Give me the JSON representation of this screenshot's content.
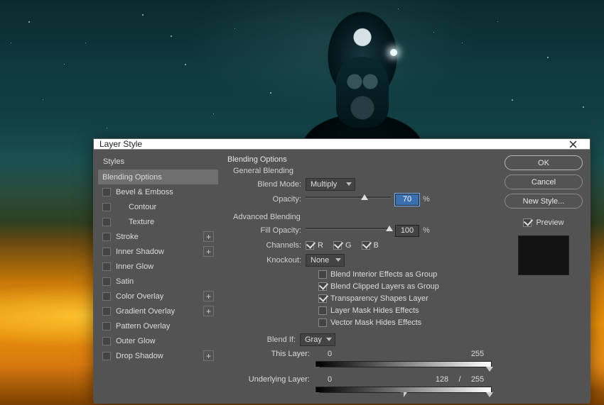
{
  "dialog": {
    "title": "Layer Style"
  },
  "styles": {
    "header": "Styles",
    "items": [
      {
        "label": "Blending Options",
        "checkbox": false,
        "selected": true,
        "plus": false,
        "indent": false
      },
      {
        "label": "Bevel & Emboss",
        "checkbox": true,
        "checked": false,
        "plus": false,
        "indent": false
      },
      {
        "label": "Contour",
        "checkbox": true,
        "checked": false,
        "plus": false,
        "indent": true
      },
      {
        "label": "Texture",
        "checkbox": true,
        "checked": false,
        "plus": false,
        "indent": true
      },
      {
        "label": "Stroke",
        "checkbox": true,
        "checked": false,
        "plus": true,
        "indent": false
      },
      {
        "label": "Inner Shadow",
        "checkbox": true,
        "checked": false,
        "plus": true,
        "indent": false
      },
      {
        "label": "Inner Glow",
        "checkbox": true,
        "checked": false,
        "plus": false,
        "indent": false
      },
      {
        "label": "Satin",
        "checkbox": true,
        "checked": false,
        "plus": false,
        "indent": false
      },
      {
        "label": "Color Overlay",
        "checkbox": true,
        "checked": false,
        "plus": true,
        "indent": false
      },
      {
        "label": "Gradient Overlay",
        "checkbox": true,
        "checked": false,
        "plus": true,
        "indent": false
      },
      {
        "label": "Pattern Overlay",
        "checkbox": true,
        "checked": false,
        "plus": false,
        "indent": false
      },
      {
        "label": "Outer Glow",
        "checkbox": true,
        "checked": false,
        "plus": false,
        "indent": false
      },
      {
        "label": "Drop Shadow",
        "checkbox": true,
        "checked": false,
        "plus": true,
        "indent": false
      }
    ]
  },
  "blending": {
    "title": "Blending Options",
    "general_title": "General Blending",
    "blend_mode_label": "Blend Mode:",
    "blend_mode_value": "Multiply",
    "opacity_label": "Opacity:",
    "opacity_value": "70",
    "pct": "%",
    "advanced_title": "Advanced Blending",
    "fill_label": "Fill Opacity:",
    "fill_value": "100",
    "channels_label": "Channels:",
    "ch_r": "R",
    "ch_g": "G",
    "ch_b": "B",
    "knockout_label": "Knockout:",
    "knockout_value": "None",
    "adv_opts": [
      {
        "label": "Blend Interior Effects as Group",
        "checked": false
      },
      {
        "label": "Blend Clipped Layers as Group",
        "checked": true
      },
      {
        "label": "Transparency Shapes Layer",
        "checked": true
      },
      {
        "label": "Layer Mask Hides Effects",
        "checked": false
      },
      {
        "label": "Vector Mask Hides Effects",
        "checked": false
      }
    ],
    "blendif_label": "Blend If:",
    "blendif_value": "Gray",
    "thislayer_label": "This Layer:",
    "thislayer_lo": "0",
    "thislayer_hi": "255",
    "underlying_label": "Underlying Layer:",
    "underlying_lo": "0",
    "underlying_mid": "128",
    "underlying_sep": "/",
    "underlying_hi": "255"
  },
  "actions": {
    "ok": "OK",
    "cancel": "Cancel",
    "new_style": "New Style...",
    "preview": "Preview"
  }
}
